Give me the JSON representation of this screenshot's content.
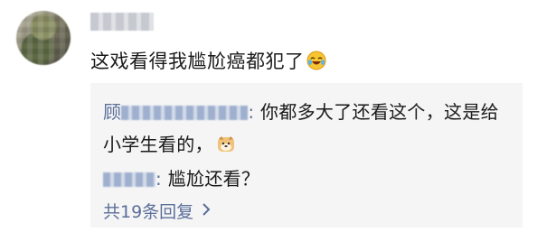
{
  "comment": {
    "text": "这戏看得我尴尬癌都犯了",
    "emoji": "laughing-crying-icon"
  },
  "replies": [
    {
      "author_visible": "顾",
      "author_tail": ":",
      "text_line1": "你都多大了还看这个，这是给",
      "text_line2": "小学生看的，",
      "emoji": "doge-icon"
    },
    {
      "author_tail": ":",
      "text": "尴尬还看？"
    }
  ],
  "more": {
    "label": "共19条回复",
    "icon": "chevron-right-icon"
  },
  "colors": {
    "link": "#5b6f9a",
    "reply_bg": "#f5f5f5",
    "text": "#1a1a1a"
  }
}
